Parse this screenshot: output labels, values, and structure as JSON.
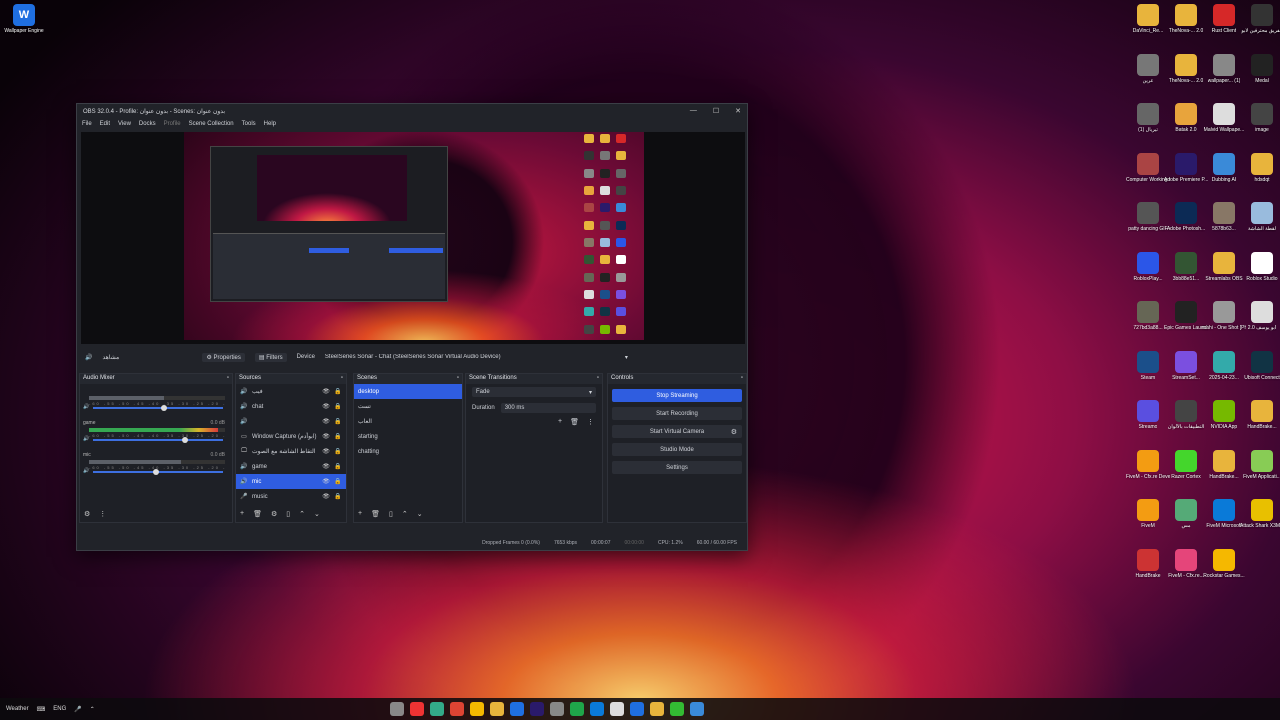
{
  "desktop_left_icon": {
    "label": "Wallpaper Engine",
    "color": "#1f6fe0",
    "icon": "wallpaper-engine-icon"
  },
  "desktop_icons": [
    {
      "label": "DaVinci_Re...",
      "color": "#e8b43c",
      "icon": "folder-icon"
    },
    {
      "label": "TheNova-... 2.0",
      "color": "#e8b43c",
      "icon": "folder-icon"
    },
    {
      "label": "Rust Client",
      "color": "#d62828",
      "icon": "rust-client-icon"
    },
    {
      "label": "الفريق محترفين لابو",
      "color": "#333",
      "icon": "shortcut-icon"
    },
    {
      "label": "عرين",
      "color": "#777",
      "icon": "image-icon"
    },
    {
      "label": "TheNova-... 2.0",
      "color": "#e8b43c",
      "icon": "folder-icon"
    },
    {
      "label": "wallpaper... (1)",
      "color": "#888",
      "icon": "image-icon"
    },
    {
      "label": "Medal",
      "color": "#222",
      "icon": "medal-icon"
    },
    {
      "label": "(1) تيريال",
      "color": "#666",
      "icon": "image-icon"
    },
    {
      "label": "Batak 2.0",
      "color": "#e8a43c",
      "icon": "folder-zip-icon"
    },
    {
      "label": "Malvid Wallpape...",
      "color": "#ddd",
      "icon": "document-icon"
    },
    {
      "label": "image",
      "color": "#444",
      "icon": "image-icon"
    },
    {
      "label": "Computer Working GIF",
      "color": "#a44",
      "icon": "gif-icon"
    },
    {
      "label": "Adobe Premiere P...",
      "color": "#2a1a6a",
      "icon": "premiere-icon"
    },
    {
      "label": "Dubbing AI",
      "color": "#3a8ad8",
      "icon": "dubbing-ai-icon"
    },
    {
      "label": "hdsdqt",
      "color": "#e8b43c",
      "icon": "folder-icon"
    },
    {
      "label": "patty dancing GIF",
      "color": "#555",
      "icon": "gif-icon"
    },
    {
      "label": "Adobe Photosh...",
      "color": "#0c2a55",
      "icon": "photoshop-icon"
    },
    {
      "label": "5878b63...",
      "color": "#876",
      "icon": "image-icon"
    },
    {
      "label": "لقطة الشاشة",
      "color": "#9bd",
      "icon": "image-icon"
    },
    {
      "label": "RobloxPlay...",
      "color": "#2b56e8",
      "icon": "roblox-icon"
    },
    {
      "label": "3bb88e51...",
      "color": "#353",
      "icon": "image-icon"
    },
    {
      "label": "Streamlabs OBS",
      "color": "#e8b43c",
      "icon": "folder-icon"
    },
    {
      "label": "Roblox Studio",
      "color": "#fff",
      "icon": "roblox-studio-icon"
    },
    {
      "label": "727bd3a88...",
      "color": "#665",
      "icon": "image-icon"
    },
    {
      "label": "Epic Games Launcher",
      "color": "#222",
      "icon": "epic-games-icon"
    },
    {
      "label": "mahi - One Shot [Ph...",
      "color": "#999",
      "icon": "audio-icon"
    },
    {
      "label": "أبو يوسف 2.0",
      "color": "#ddd",
      "icon": "document-icon"
    },
    {
      "label": "Steam",
      "color": "#1b4f8a",
      "icon": "steam-icon"
    },
    {
      "label": "StreamSet...",
      "color": "#7b4fe0",
      "icon": "streamset-icon"
    },
    {
      "label": "2025-04-23...",
      "color": "#3aa",
      "icon": "image-icon"
    },
    {
      "label": "Ubisoft Connect",
      "color": "#134",
      "icon": "ubisoft-icon"
    },
    {
      "label": "Streamo",
      "color": "#5a4fe0",
      "icon": "streamo-icon"
    },
    {
      "label": "التطبيقات بالألوان",
      "color": "#444",
      "icon": "image-icon"
    },
    {
      "label": "NVIDIA App",
      "color": "#76b900",
      "icon": "nvidia-icon"
    },
    {
      "label": "HandBrake...",
      "color": "#e8b43c",
      "icon": "folder-icon"
    },
    {
      "label": "FiveM - Cfx.re Devel...",
      "color": "#f39c12",
      "icon": "fivem-icon"
    },
    {
      "label": "Razer Cortex",
      "color": "#44d62c",
      "icon": "razer-icon"
    },
    {
      "label": "HandBrake...",
      "color": "#e8b43c",
      "icon": "folder-icon"
    },
    {
      "label": "FiveM Applicati...",
      "color": "#8c5",
      "icon": "fivem-app-icon"
    },
    {
      "label": "FiveM",
      "color": "#f39c12",
      "icon": "fivem-icon"
    },
    {
      "label": "مس",
      "color": "#5a7",
      "icon": "document-icon"
    },
    {
      "label": "FiveM Microsoft",
      "color": "#0a7ad8",
      "icon": "edge-icon"
    },
    {
      "label": "Attack Shark X3M...",
      "color": "#e8c000",
      "icon": "attack-shark-icon"
    },
    {
      "label": "HandBrake",
      "color": "#c33",
      "icon": "handbrake-icon"
    },
    {
      "label": "FiveM - Cfx.re...",
      "color": "#e5457a",
      "icon": "fivem-icon"
    },
    {
      "label": "Rockstar Games...",
      "color": "#f5b800",
      "icon": "rockstar-icon"
    }
  ],
  "obs": {
    "title": "OBS 32.0.4 - Profile: بدون عنوان - Scenes: بدون عنوان",
    "menu": [
      "File",
      "Edit",
      "View",
      "Docks",
      "Profile",
      "Scene Collection",
      "Tools",
      "Help"
    ],
    "props_bar": {
      "source_name": "مشاهد",
      "properties": "Properties",
      "filters": "Filters",
      "device_label": "Device",
      "device_value": "SteelSeries Sonar - Chat (SteelSeries Sonar Virtual Audio Device)"
    },
    "audio_mixer": {
      "title": "Audio Mixer",
      "channels": [
        {
          "name": "",
          "db": "",
          "level": 0.55,
          "volume": 0.55,
          "meter_color": "#5c6068"
        },
        {
          "name": "game",
          "db": "0.0 dB",
          "level": 0.95,
          "volume": 0.72,
          "meter_color": "#36a852"
        },
        {
          "name": "mic",
          "db": "0.0 dB",
          "level": 0.68,
          "volume": 0.48,
          "meter_color": "#5c6068"
        }
      ],
      "ticks": "-60 -55 -50 -45 -40 -35 -30 -25 -20 -15 -10 -5 0"
    },
    "sources": {
      "title": "Sources",
      "items": [
        {
          "icon": "speaker-icon",
          "name": "فيب",
          "selected": false
        },
        {
          "icon": "speaker-icon",
          "name": "chat",
          "selected": false
        },
        {
          "icon": "speaker-icon",
          "name": "",
          "selected": false
        },
        {
          "icon": "window-icon",
          "name": "Window Capture (ابوأدم)",
          "selected": false
        },
        {
          "icon": "monitor-icon",
          "name": "التقاط الشاشة مع الصوت",
          "selected": false
        },
        {
          "icon": "speaker-icon",
          "name": "game",
          "selected": false
        },
        {
          "icon": "speaker-icon",
          "name": "mic",
          "selected": true
        },
        {
          "icon": "mic-icon",
          "name": "music",
          "selected": false
        }
      ]
    },
    "scenes": {
      "title": "Scenes",
      "items": [
        {
          "name": "desktop",
          "selected": true
        },
        {
          "name": "تست",
          "selected": false
        },
        {
          "name": "العاب",
          "selected": false
        },
        {
          "name": "starting",
          "selected": false
        },
        {
          "name": "chatting",
          "selected": false
        }
      ]
    },
    "transitions": {
      "title": "Scene Transitions",
      "type": "Fade",
      "duration_label": "Duration",
      "duration_value": "300 ms"
    },
    "controls": {
      "title": "Controls",
      "buttons": [
        "Stop Streaming",
        "Start Recording",
        "Start Virtual Camera",
        "Studio Mode",
        "Settings"
      ]
    },
    "status": {
      "dropped": "Dropped Frames 0 (0.0%)",
      "kbps": "7653 kbps",
      "stream_time": "00:00:07",
      "rec_time": "00:00:00",
      "cpu": "CPU: 1.2%",
      "fps": "60.00 / 60.00 FPS"
    }
  },
  "taskbar": {
    "left_text": "Weather",
    "lang": "ENG",
    "apps_colors": [
      "#888",
      "#e33",
      "#3a8",
      "#d43",
      "#f5b800",
      "#e8b43c",
      "#1f6fe0",
      "#2a1a6a",
      "#888",
      "#1fa64a",
      "#0a7ad8",
      "#ddd",
      "#1f6fe0",
      "#e8b43c",
      "#3b3",
      "#3a8ad8"
    ],
    "time": "",
    "accent": "#2f5de0"
  }
}
